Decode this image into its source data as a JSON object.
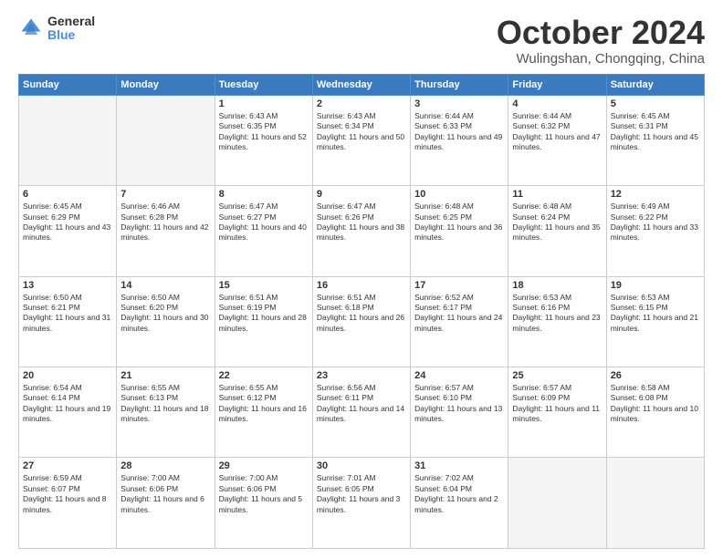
{
  "logo": {
    "general": "General",
    "blue": "Blue"
  },
  "header": {
    "month": "October 2024",
    "location": "Wulingshan, Chongqing, China"
  },
  "weekdays": [
    "Sunday",
    "Monday",
    "Tuesday",
    "Wednesday",
    "Thursday",
    "Friday",
    "Saturday"
  ],
  "weeks": [
    [
      {
        "day": "",
        "empty": true
      },
      {
        "day": "",
        "empty": true
      },
      {
        "day": "1",
        "rise": "6:43 AM",
        "set": "6:35 PM",
        "daylight": "11 hours and 52 minutes."
      },
      {
        "day": "2",
        "rise": "6:43 AM",
        "set": "6:34 PM",
        "daylight": "11 hours and 50 minutes."
      },
      {
        "day": "3",
        "rise": "6:44 AM",
        "set": "6:33 PM",
        "daylight": "11 hours and 49 minutes."
      },
      {
        "day": "4",
        "rise": "6:44 AM",
        "set": "6:32 PM",
        "daylight": "11 hours and 47 minutes."
      },
      {
        "day": "5",
        "rise": "6:45 AM",
        "set": "6:31 PM",
        "daylight": "11 hours and 45 minutes."
      }
    ],
    [
      {
        "day": "6",
        "rise": "6:45 AM",
        "set": "6:29 PM",
        "daylight": "11 hours and 43 minutes."
      },
      {
        "day": "7",
        "rise": "6:46 AM",
        "set": "6:28 PM",
        "daylight": "11 hours and 42 minutes."
      },
      {
        "day": "8",
        "rise": "6:47 AM",
        "set": "6:27 PM",
        "daylight": "11 hours and 40 minutes."
      },
      {
        "day": "9",
        "rise": "6:47 AM",
        "set": "6:26 PM",
        "daylight": "11 hours and 38 minutes."
      },
      {
        "day": "10",
        "rise": "6:48 AM",
        "set": "6:25 PM",
        "daylight": "11 hours and 36 minutes."
      },
      {
        "day": "11",
        "rise": "6:48 AM",
        "set": "6:24 PM",
        "daylight": "11 hours and 35 minutes."
      },
      {
        "day": "12",
        "rise": "6:49 AM",
        "set": "6:22 PM",
        "daylight": "11 hours and 33 minutes."
      }
    ],
    [
      {
        "day": "13",
        "rise": "6:50 AM",
        "set": "6:21 PM",
        "daylight": "11 hours and 31 minutes."
      },
      {
        "day": "14",
        "rise": "6:50 AM",
        "set": "6:20 PM",
        "daylight": "11 hours and 30 minutes."
      },
      {
        "day": "15",
        "rise": "6:51 AM",
        "set": "6:19 PM",
        "daylight": "11 hours and 28 minutes."
      },
      {
        "day": "16",
        "rise": "6:51 AM",
        "set": "6:18 PM",
        "daylight": "11 hours and 26 minutes."
      },
      {
        "day": "17",
        "rise": "6:52 AM",
        "set": "6:17 PM",
        "daylight": "11 hours and 24 minutes."
      },
      {
        "day": "18",
        "rise": "6:53 AM",
        "set": "6:16 PM",
        "daylight": "11 hours and 23 minutes."
      },
      {
        "day": "19",
        "rise": "6:53 AM",
        "set": "6:15 PM",
        "daylight": "11 hours and 21 minutes."
      }
    ],
    [
      {
        "day": "20",
        "rise": "6:54 AM",
        "set": "6:14 PM",
        "daylight": "11 hours and 19 minutes."
      },
      {
        "day": "21",
        "rise": "6:55 AM",
        "set": "6:13 PM",
        "daylight": "11 hours and 18 minutes."
      },
      {
        "day": "22",
        "rise": "6:55 AM",
        "set": "6:12 PM",
        "daylight": "11 hours and 16 minutes."
      },
      {
        "day": "23",
        "rise": "6:56 AM",
        "set": "6:11 PM",
        "daylight": "11 hours and 14 minutes."
      },
      {
        "day": "24",
        "rise": "6:57 AM",
        "set": "6:10 PM",
        "daylight": "11 hours and 13 minutes."
      },
      {
        "day": "25",
        "rise": "6:57 AM",
        "set": "6:09 PM",
        "daylight": "11 hours and 11 minutes."
      },
      {
        "day": "26",
        "rise": "6:58 AM",
        "set": "6:08 PM",
        "daylight": "11 hours and 10 minutes."
      }
    ],
    [
      {
        "day": "27",
        "rise": "6:59 AM",
        "set": "6:07 PM",
        "daylight": "11 hours and 8 minutes."
      },
      {
        "day": "28",
        "rise": "7:00 AM",
        "set": "6:06 PM",
        "daylight": "11 hours and 6 minutes."
      },
      {
        "day": "29",
        "rise": "7:00 AM",
        "set": "6:06 PM",
        "daylight": "11 hours and 5 minutes."
      },
      {
        "day": "30",
        "rise": "7:01 AM",
        "set": "6:05 PM",
        "daylight": "11 hours and 3 minutes."
      },
      {
        "day": "31",
        "rise": "7:02 AM",
        "set": "6:04 PM",
        "daylight": "11 hours and 2 minutes."
      },
      {
        "day": "",
        "empty": true
      },
      {
        "day": "",
        "empty": true
      }
    ]
  ]
}
